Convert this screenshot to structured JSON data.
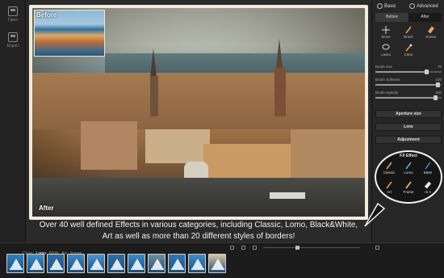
{
  "left_sidebar": {
    "items": [
      {
        "label": "Open",
        "icon": "folder-icon"
      },
      {
        "label": "Export",
        "icon": "export-icon"
      }
    ]
  },
  "photo": {
    "before_label": "Before",
    "after_label": "After"
  },
  "caption": {
    "line1": "Over 40 well defined Effects in various categories, including Classic, Lomo, Black&White,",
    "line2": "Art as well as more than 20 different styles of borders!"
  },
  "right_panel": {
    "mode_tabs": [
      {
        "label": "Basic",
        "selected": true
      },
      {
        "label": "Advanced",
        "selected": false
      }
    ],
    "before_after": [
      {
        "label": "Before",
        "active": true
      },
      {
        "label": "After",
        "active": false
      }
    ],
    "tools": [
      {
        "label": "Move",
        "icon": "move-icon"
      },
      {
        "label": "Brush",
        "icon": "brush-icon"
      },
      {
        "label": "Eraser",
        "icon": "eraser-icon"
      },
      {
        "label": "Lasso",
        "icon": "lasso-icon"
      },
      {
        "label": "Clear",
        "icon": "clear-icon"
      }
    ],
    "sliders": [
      {
        "label": "Brush size",
        "value": "70",
        "fraction": 0.78
      },
      {
        "label": "Brush Softness",
        "value": "100",
        "fraction": 0.95
      },
      {
        "label": "Brush Opacity",
        "value": "200",
        "fraction": 0.92
      }
    ],
    "sections": [
      {
        "label": "Aperture size"
      },
      {
        "label": "Lens"
      },
      {
        "label": "Adjustment"
      }
    ]
  },
  "fx_panel": {
    "title": "FX Effect",
    "tools": [
      {
        "label": "Classic",
        "icon": "pencil-icon"
      },
      {
        "label": "Lomo",
        "icon": "brush-icon"
      },
      {
        "label": "B&W",
        "icon": "pen-icon"
      },
      {
        "label": "Art",
        "icon": "paintbrush-icon"
      },
      {
        "label": "Frame",
        "icon": "frame-brush-icon"
      },
      {
        "label": "At A",
        "icon": "eraser-icon"
      }
    ]
  },
  "filmstrip": {
    "tabs": [
      {
        "label": "Class",
        "active": false
      },
      {
        "label": "Lomo",
        "active": true
      },
      {
        "label": "B&W",
        "active": false
      },
      {
        "label": "Art",
        "active": false
      },
      {
        "label": "Frame",
        "active": false
      }
    ],
    "thumbnails": [
      {
        "name": "effect-1",
        "color": "#2d7fc1"
      },
      {
        "name": "effect-2",
        "color": "#3b8ed0"
      },
      {
        "name": "effect-3",
        "color": "#2f6fa8"
      },
      {
        "name": "effect-4",
        "color": "#3c87c7"
      },
      {
        "name": "effect-5",
        "color": "#4795d4"
      },
      {
        "name": "effect-6",
        "color": "#2c6ea3"
      },
      {
        "name": "effect-7",
        "color": "#358ac8"
      },
      {
        "name": "effect-8",
        "color": "#6f8f9a"
      },
      {
        "name": "effect-9",
        "color": "#2e78b6"
      },
      {
        "name": "effect-10",
        "color": "#3f8ccb"
      },
      {
        "name": "effect-11",
        "color": "#d9c4a2"
      }
    ]
  },
  "colors": {
    "frame": "#f1ecd9",
    "panel_bg": "#262626",
    "accent_white": "#f0f0f0"
  }
}
